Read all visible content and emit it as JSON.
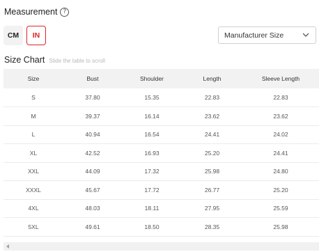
{
  "measurement": {
    "title": "Measurement",
    "help_icon": "?"
  },
  "units": {
    "cm_label": "CM",
    "in_label": "IN",
    "selected": "IN",
    "accent": "#e02424"
  },
  "size_select": {
    "value": "Manufacturer Size"
  },
  "size_chart": {
    "title": "Size Chart",
    "hint": "Slide the table to scroll",
    "columns": [
      "Size",
      "Bust",
      "Shoulder",
      "Length",
      "Sleeve Length"
    ],
    "rows": [
      [
        "S",
        "37.80",
        "15.35",
        "22.83",
        "22.83"
      ],
      [
        "M",
        "39.37",
        "16.14",
        "23.62",
        "23.62"
      ],
      [
        "L",
        "40.94",
        "16.54",
        "24.41",
        "24.02"
      ],
      [
        "XL",
        "42.52",
        "16.93",
        "25.20",
        "24.41"
      ],
      [
        "XXL",
        "44.09",
        "17.32",
        "25.98",
        "24.80"
      ],
      [
        "XXXL",
        "45.67",
        "17.72",
        "26.77",
        "25.20"
      ],
      [
        "4XL",
        "48.03",
        "18.11",
        "27.95",
        "25.59"
      ],
      [
        "5XL",
        "49.61",
        "18.50",
        "28.35",
        "25.98"
      ]
    ]
  }
}
